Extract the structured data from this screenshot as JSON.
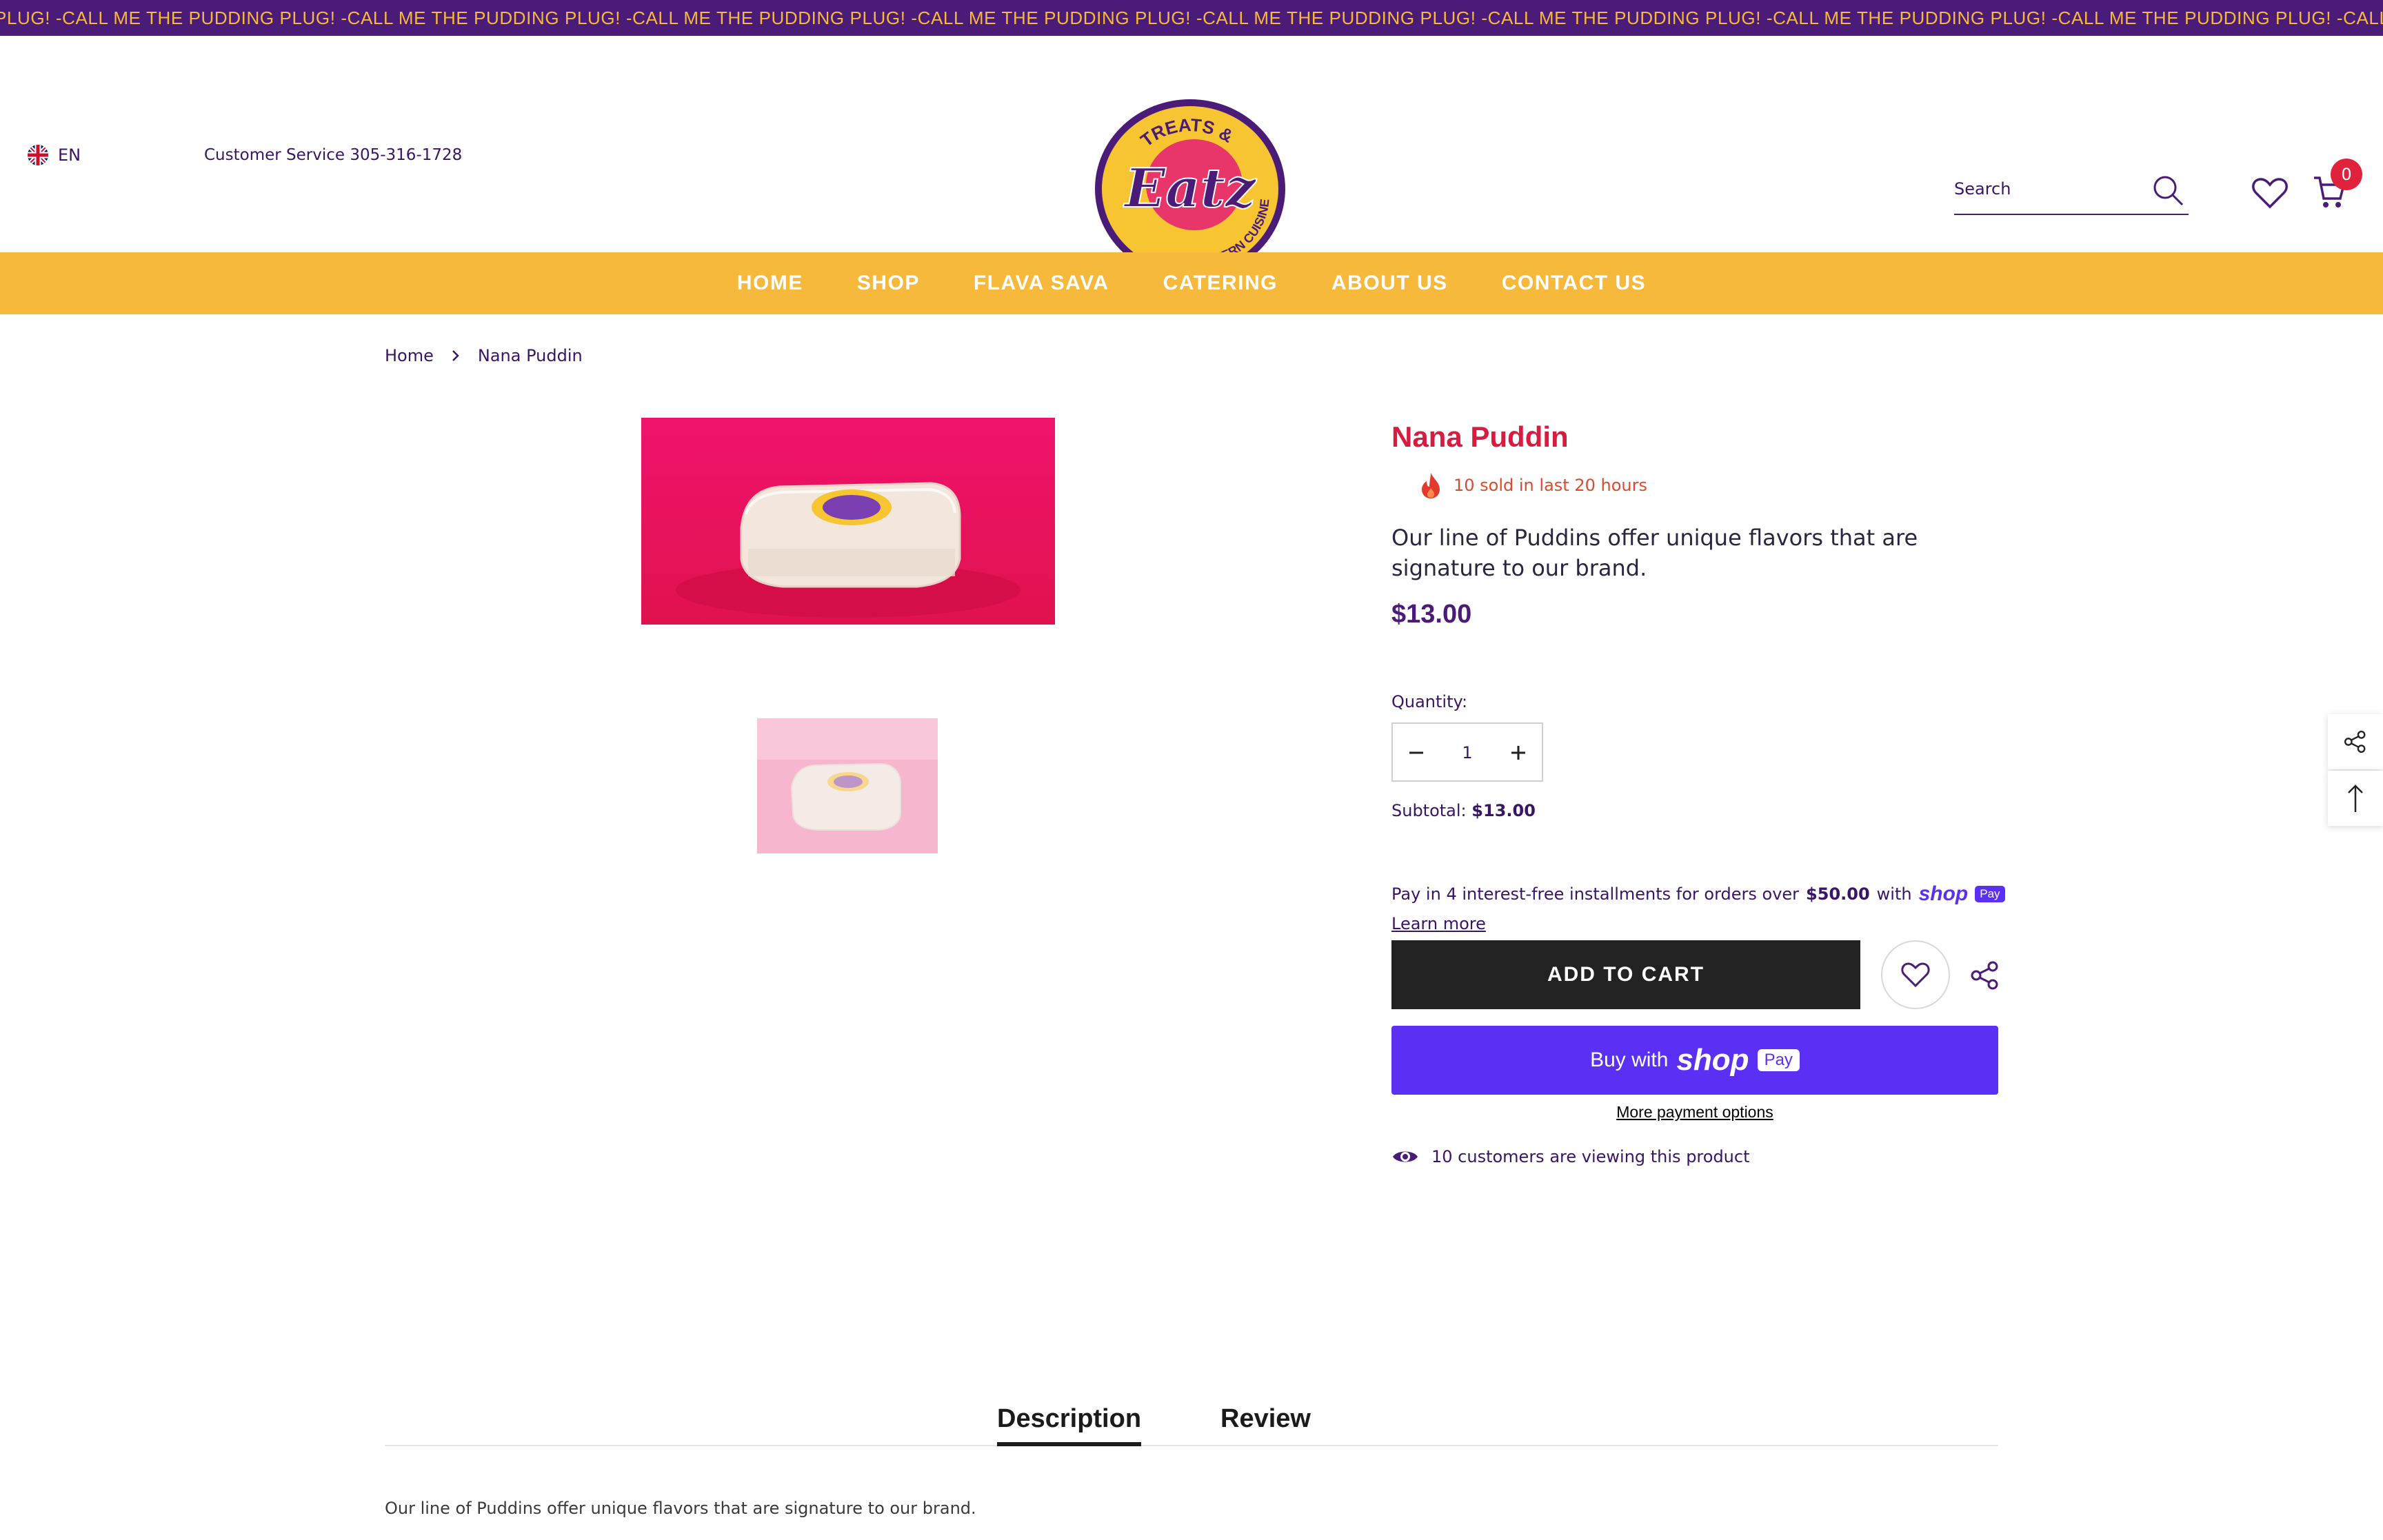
{
  "announcement": {
    "text": "PLUG! -CALL ME THE PUDDING PLUG! -CALL ME THE PUDDING PLUG! -CALL ME THE PUDDING PLUG! -CALL ME THE PUDDING PLUG! -CALL ME THE PUDDING PLUG! -CALL ME THE PUDDING PLUG! -CALL ME THE PUDDING PLUG! -CALL ME THE PUDDING PLUG! -CALL ME THE PUDDING PLUG! -CALL ME THE"
  },
  "header": {
    "language": "EN",
    "customer_service": "Customer Service 305-316-1728",
    "logo": {
      "top_text": "TREATS &",
      "main_text": "Eatz",
      "bottom_text": "SOUTHERN CUISINE"
    },
    "search_placeholder": "Search",
    "cart_count": "0"
  },
  "nav": {
    "items": [
      "HOME",
      "SHOP",
      "FLAVA SAVA",
      "CATERING",
      "ABOUT US",
      "CONTACT US"
    ]
  },
  "breadcrumb": {
    "home": "Home",
    "current": "Nana Puddin"
  },
  "product": {
    "title": "Nana Puddin",
    "sold_text": "10 sold in last 20 hours",
    "description": "Our line of Puddins offer unique flavors that are signature to our brand.",
    "price": "$13.00",
    "quantity_label": "Quantity:",
    "quantity_value": "1",
    "subtotal_label": "Subtotal:",
    "subtotal_value": "$13.00",
    "installments": {
      "prefix": "Pay in 4 interest-free installments for orders over",
      "amount": "$50.00",
      "suffix": "with",
      "brand": "shop",
      "pay": "Pay"
    },
    "learn_more": "Learn more",
    "add_to_cart": "ADD TO CART",
    "buy_with": "Buy with",
    "buy_brand": "shop",
    "buy_pay": "Pay",
    "more_payment": "More payment options",
    "viewing_text": "10 customers are viewing this product"
  },
  "tabs": {
    "description": "Description",
    "review": "Review"
  },
  "description_body": "Our line of Puddins offer unique flavors that are signature to our brand.",
  "colors": {
    "brand_purple": "#4b1c77",
    "brand_yellow": "#f7b93c",
    "title_red": "#d71d3f",
    "shop_pay_purple": "#5a31f4"
  }
}
